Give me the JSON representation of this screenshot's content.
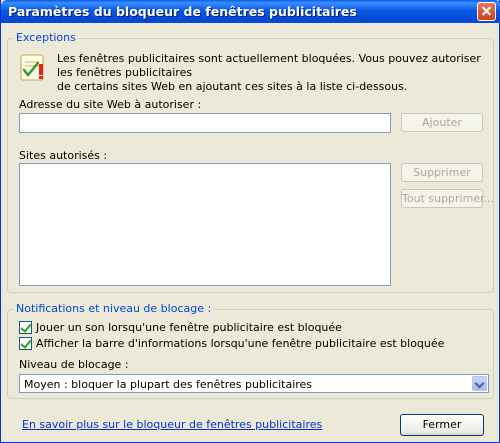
{
  "window": {
    "title": "Paramètres du bloqueur de fenêtres publicitaires"
  },
  "exceptions": {
    "legend": "Exceptions",
    "info_line1": "Les fenêtres publicitaires sont actuellement bloquées.  Vous pouvez autoriser les fenêtres publicitaires",
    "info_line2": "de certains sites Web en ajoutant ces sites à la liste ci-dessous.",
    "address_label": "Adresse du site Web à autoriser :",
    "address_value": "",
    "add_button": "Ajouter",
    "allowed_label": "Sites autorisés :",
    "allowed_sites": [],
    "remove_button": "Supprimer",
    "remove_all_button": "Tout supprimer..."
  },
  "notifications": {
    "legend": "Notifications et niveau de blocage :",
    "sound_checkbox": {
      "label": "Jouer un son lorsqu'une fenêtre publicitaire est bloquée",
      "checked": true
    },
    "infobar_checkbox": {
      "label": "Afficher la barre d'informations lorsqu'une fenêtre publicitaire est bloquée",
      "checked": true
    },
    "level_label": "Niveau de blocage :",
    "level_value": "Moyen : bloquer la plupart des fenêtres publicitaires"
  },
  "footer": {
    "learn_more_link": "En savoir plus sur le bloqueur de fenêtres publicitaires",
    "close_button": "Fermer"
  }
}
